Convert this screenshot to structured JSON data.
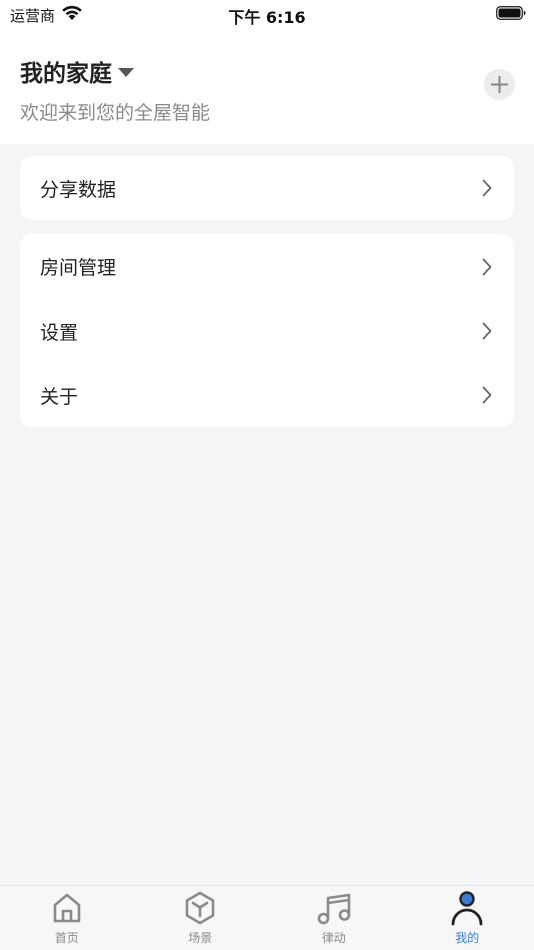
{
  "status_bar": {
    "carrier": "运营商",
    "time": "下午 6:16"
  },
  "header": {
    "home_name": "我的家庭",
    "subtitle": "欢迎来到您的全屋智能"
  },
  "menu": {
    "group1": [
      {
        "label": "分享数据"
      }
    ],
    "group2": [
      {
        "label": "房间管理"
      },
      {
        "label": "设置"
      },
      {
        "label": "关于"
      }
    ]
  },
  "tab_bar": {
    "tabs": [
      {
        "label": "首页",
        "icon": "home-icon"
      },
      {
        "label": "场景",
        "icon": "cube-icon"
      },
      {
        "label": "律动",
        "icon": "music-note-icon"
      },
      {
        "label": "我的",
        "icon": "profile-icon"
      }
    ],
    "active_index": 3
  },
  "colors": {
    "background": "#f4f5f7",
    "card": "#ffffff",
    "accent": "#3a7bd5",
    "inactive": "#8a8a8a"
  }
}
